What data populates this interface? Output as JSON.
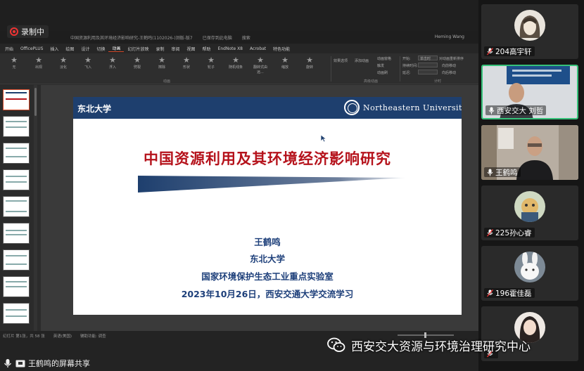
{
  "recording": {
    "label": "录制中"
  },
  "ppt": {
    "title_parts": [
      "中国资源利用及其环境经济影响研究-王鹤鸣(1102026-)测版-版7",
      "已保存到此电脑",
      "搜索"
    ],
    "user": "Heming Wang",
    "menu": [
      "开始",
      "OfficePLUS",
      "插入",
      "绘图",
      "设计",
      "切换",
      "动画",
      "幻灯片放映",
      "录制",
      "审阅",
      "视图",
      "帮助",
      "EndNote X8",
      "Acrobat",
      "特色功能"
    ],
    "active_menu": "动画",
    "animations": [
      "无",
      "出现",
      "淡化",
      "飞入",
      "浮入",
      "劈裂",
      "擦除",
      "形状",
      "轮子",
      "随机线条",
      "翻转式由远...",
      "缩放",
      "旋转"
    ],
    "ribbon_groups": {
      "animation": "动画",
      "advanced": "高级动画",
      "timing": "计时"
    },
    "ribbon_small": {
      "effect_options": "效果选项",
      "add_animation": "添加动画",
      "animation_pane": "动画窗格",
      "trigger": "触发",
      "animation_painter": "动画刷",
      "start": "开始:",
      "start_value": "单击时",
      "duration": "持续时间:",
      "delay": "延迟:",
      "reorder": "对动画重新排序",
      "move_earlier": "向前移动",
      "move_later": "向后移动",
      "preview": "预览"
    },
    "status": [
      "幻灯片 第1张，共 58 张",
      "英语(美国)",
      "辅助功能: 调查"
    ]
  },
  "slide": {
    "university": "东北大学",
    "logo_text": "Northeastern University",
    "title": "中国资源利用及其环境经济影响研究",
    "presenter": "王鹤鸣",
    "affiliation": "东北大学",
    "lab": "国家环境保护生态工业重点实验室",
    "date_event": "2023年10月26日，西安交通大学交流学习",
    "header_color": "#1e3f6e",
    "title_color": "#b5121b",
    "text_color": "#1d3f7a"
  },
  "share_bar": {
    "label": "王鹤鸣的屏幕共享"
  },
  "participants": [
    {
      "name": "204高宇轩",
      "muted": true,
      "active": false
    },
    {
      "name": "西安交大 刘哲",
      "muted": false,
      "active": true
    },
    {
      "name": "王鹤鸣",
      "muted": false,
      "active": false
    },
    {
      "name": "225孙心睿",
      "muted": true,
      "active": false
    },
    {
      "name": "196霍佳磊",
      "muted": true,
      "active": false
    },
    {
      "name": "",
      "muted": true,
      "active": false
    }
  ],
  "watermark": {
    "text": "西安交大资源与环境治理研究中心"
  }
}
